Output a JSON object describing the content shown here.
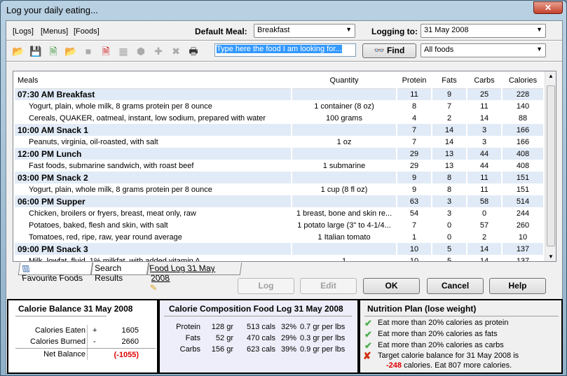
{
  "window": {
    "title": "Log your daily eating...",
    "close": "✕"
  },
  "menu": {
    "logs": "[Logs]",
    "menus": "[Menus]",
    "foods": "[Foods]"
  },
  "default_meal": {
    "label": "Default Meal:",
    "value": "Breakfast"
  },
  "logging_to": {
    "label": "Logging to:",
    "value": "31 May 2008"
  },
  "search": {
    "placeholder": "Type here the food I am looking for...",
    "find": "Find",
    "filter": "All foods"
  },
  "table": {
    "headers": [
      "Meals",
      "Quantity",
      "Protein",
      "Fats",
      "Carbs",
      "Calories"
    ],
    "rows": [
      {
        "type": "meal",
        "name": "07:30 AM Breakfast",
        "qty": "",
        "p": "11",
        "f": "9",
        "c": "25",
        "cal": "228"
      },
      {
        "type": "item",
        "name": "Yogurt, plain, whole milk, 8 grams protein per 8 ounce",
        "qty": "1 container (8 oz)",
        "p": "8",
        "f": "7",
        "c": "11",
        "cal": "140"
      },
      {
        "type": "item",
        "name": "Cereals, QUAKER, oatmeal, instant, low sodium, prepared with water",
        "qty": "100 grams",
        "p": "4",
        "f": "2",
        "c": "14",
        "cal": "88"
      },
      {
        "type": "meal",
        "name": "10:00 AM Snack 1",
        "qty": "",
        "p": "7",
        "f": "14",
        "c": "3",
        "cal": "166"
      },
      {
        "type": "item",
        "name": "Peanuts, virginia, oil-roasted, with salt",
        "qty": "1 oz",
        "p": "7",
        "f": "14",
        "c": "3",
        "cal": "166"
      },
      {
        "type": "meal",
        "name": "12:00 PM Lunch",
        "qty": "",
        "p": "29",
        "f": "13",
        "c": "44",
        "cal": "408"
      },
      {
        "type": "item",
        "name": "Fast foods, submarine sandwich, with roast beef",
        "qty": "1 submarine",
        "p": "29",
        "f": "13",
        "c": "44",
        "cal": "408"
      },
      {
        "type": "meal",
        "name": "03:00 PM Snack 2",
        "qty": "",
        "p": "9",
        "f": "8",
        "c": "11",
        "cal": "151"
      },
      {
        "type": "item",
        "name": "Yogurt, plain, whole milk, 8 grams protein per 8 ounce",
        "qty": "1 cup (8 fl oz)",
        "p": "9",
        "f": "8",
        "c": "11",
        "cal": "151"
      },
      {
        "type": "meal",
        "name": "06:00 PM Supper",
        "qty": "",
        "p": "63",
        "f": "3",
        "c": "58",
        "cal": "514"
      },
      {
        "type": "item",
        "name": "Chicken, broilers or fryers, breast, meat only, raw",
        "qty": "1 breast, bone and skin re...",
        "p": "54",
        "f": "3",
        "c": "0",
        "cal": "244"
      },
      {
        "type": "item",
        "name": "Potatoes, baked, flesh and skin, with salt",
        "qty": "1 potato large (3\" to 4-1/4...",
        "p": "7",
        "f": "0",
        "c": "57",
        "cal": "260"
      },
      {
        "type": "item",
        "name": "Tomatoes, red, ripe, raw, year round average",
        "qty": "1 Italian tomato",
        "p": "1",
        "f": "0",
        "c": "2",
        "cal": "10"
      },
      {
        "type": "meal",
        "name": "09:00 PM Snack 3",
        "qty": "",
        "p": "10",
        "f": "5",
        "c": "14",
        "cal": "137"
      },
      {
        "type": "item",
        "name": "Milk, lowfat, fluid, 1% milkfat, with added vitamin A",
        "qty": "1",
        "p": "10",
        "f": "5",
        "c": "14",
        "cal": "137"
      }
    ]
  },
  "tabs": [
    "Favourite Foods",
    "Search Results",
    "Food Log 31 May 2008"
  ],
  "buttons": {
    "log": "Log",
    "edit": "Edit",
    "ok": "OK",
    "cancel": "Cancel",
    "help": "Help"
  },
  "balance": {
    "title": "Calorie Balance  31 May 2008",
    "eaten_label": "Calories Eaten",
    "eaten_sign": "+",
    "eaten": "1605",
    "burned_label": "Calories Burned",
    "burned_sign": "-",
    "burned": "2660",
    "net_label": "Net Balance",
    "net": "(-1055)"
  },
  "composition": {
    "title": "Calorie Composition  Food Log 31 May 2008",
    "rows": [
      {
        "name": "Protein",
        "gr": "128 gr",
        "cals": "513 cals",
        "pct": "32%",
        "per": "0.7 gr per lbs"
      },
      {
        "name": "Fats",
        "gr": "52 gr",
        "cals": "470 cals",
        "pct": "29%",
        "per": "0.3 gr per lbs"
      },
      {
        "name": "Carbs",
        "gr": "156 gr",
        "cals": "623 cals",
        "pct": "39%",
        "per": "0.9 gr per lbs"
      }
    ]
  },
  "plan": {
    "title": "Nutrition Plan  (lose weight)",
    "items": [
      "Eat more than 20% calories as protein",
      "Eat more than 20% calories as fats",
      "Eat more than 20% calories as carbs"
    ],
    "target_line1": "Target calorie balance for 31 May 2008 is",
    "target_value": "-248",
    "target_line2": " calories. Eat 807 more calories."
  },
  "colors": {
    "meal_row": "#e1ebf7",
    "negative": "#e00000",
    "composition_bg": "#eeeefa"
  }
}
